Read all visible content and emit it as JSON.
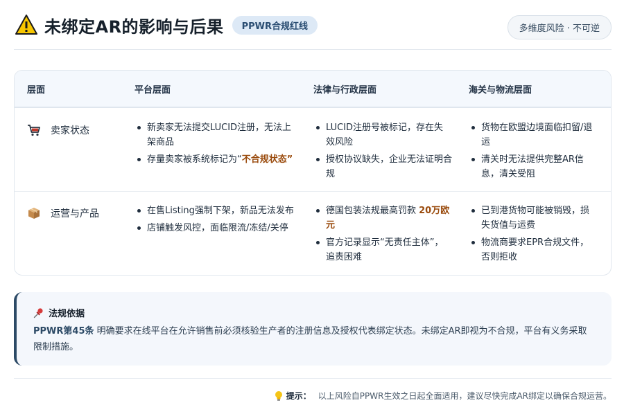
{
  "header": {
    "title": "未绑定AR的影响与后果",
    "badge": "PPWR合规红线",
    "tag": "多维度风险 · 不可逆"
  },
  "table": {
    "headers": [
      "层面",
      "平台层面",
      "法律与行政层面",
      "海关与物流层面"
    ],
    "rows": [
      {
        "icon": "shopping-cart-icon",
        "label": "卖家状态",
        "platform": [
          {
            "text": "新卖家无法提交LUCID注册，无法上架商品"
          },
          {
            "pre": "存量卖家被系统标记为“",
            "hl": "不合规状态",
            "post": "”"
          }
        ],
        "legal": [
          {
            "text": "LUCID注册号被标记，存在失效风险"
          },
          {
            "text": "授权协议缺失，企业无法证明合规"
          }
        ],
        "customs": [
          {
            "text": "货物在欧盟边境面临扣留/退运"
          },
          {
            "text": "清关时无法提供完整AR信息，清关受阻"
          }
        ]
      },
      {
        "icon": "package-icon",
        "label": "运营与产品",
        "platform": [
          {
            "text": "在售Listing强制下架，新品无法发布"
          },
          {
            "text": "店铺触发风控，面临限流/冻结/关停"
          }
        ],
        "legal": [
          {
            "pre": "德国包装法规最高罚款 ",
            "hl": "20万欧元",
            "post": ""
          },
          {
            "text": "官方记录显示“无责任主体”，追责困难"
          }
        ],
        "customs": [
          {
            "text": "已到港货物可能被销毁，损失货值与运费"
          },
          {
            "text": "物流商要求EPR合规文件，否则拒收"
          }
        ]
      }
    ]
  },
  "basis": {
    "title": "法规依据",
    "article": "PPWR第45条",
    "text": " 明确要求在线平台在允许销售前必须核验生产者的注册信息及授权代表绑定状态。未绑定AR即视为不合规，平台有义务采取限制措施。"
  },
  "footer": {
    "label": "提示：",
    "text": "以上风险自PPWR生效之日起全面适用，建议尽快完成AR绑定以确保合规运营。"
  }
}
